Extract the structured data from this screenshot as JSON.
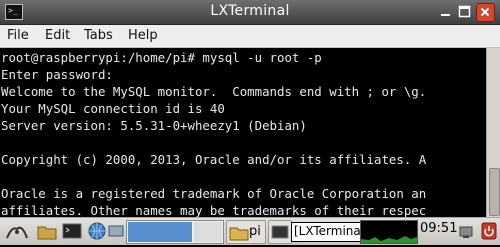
{
  "window": {
    "title": "LXTerminal"
  },
  "menu": {
    "file": "File",
    "edit": "Edit",
    "tabs": "Tabs",
    "help": "Help"
  },
  "terminal": {
    "lines": [
      "root@raspberrypi:/home/pi# mysql -u root -p",
      "Enter password:",
      "Welcome to the MySQL monitor.  Commands end with ; or \\g.",
      "Your MySQL connection id is 40",
      "Server version: 5.5.31-0+wheezy1 (Debian)",
      "",
      "Copyright (c) 2000, 2013, Oracle and/or its affiliates. A",
      "",
      "Oracle is a registered trademark of Oracle Corporation an",
      "affiliates. Other names may be trademarks of their respec"
    ]
  },
  "taskbar": {
    "folder_task_label": "pi",
    "terminal_task_label": "[LXTerminal]",
    "clock": "09:51"
  },
  "colors": {
    "titlebar": "#4a4a4a",
    "close_button": "#d14730",
    "terminal_bg": "#000000",
    "terminal_fg": "#e8e8e8"
  }
}
